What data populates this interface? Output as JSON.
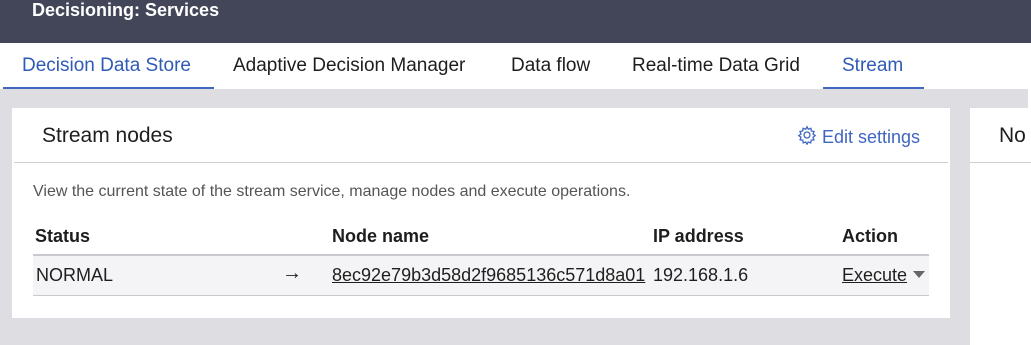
{
  "header": {
    "title": "Decisioning: Services"
  },
  "tabs": [
    {
      "label": "Decision Data Store"
    },
    {
      "label": "Adaptive Decision Manager"
    },
    {
      "label": "Data flow"
    },
    {
      "label": "Real-time Data Grid"
    },
    {
      "label": "Stream"
    }
  ],
  "stream_card": {
    "title": "Stream nodes",
    "edit_settings": "Edit settings",
    "description": "View the current state of the stream service, manage nodes and execute operations.",
    "columns": [
      "Status",
      "Node name",
      "IP address",
      "Action"
    ],
    "rows": [
      {
        "status": "NORMAL",
        "arrow": "→",
        "node_name": "8ec92e79b3d58d2f9685136c571d8a01",
        "ip_address": "192.168.1.6",
        "action": "Execute"
      }
    ]
  },
  "second_card": {
    "title_visible": "No"
  },
  "colors": {
    "header_bg": "#434659",
    "accent": "#3f66c0",
    "page_bg": "#dddde2"
  },
  "icons": {
    "edit_settings": "gear-icon",
    "row_arrow": "arrow-right-icon",
    "action_menu": "caret-down-icon"
  }
}
